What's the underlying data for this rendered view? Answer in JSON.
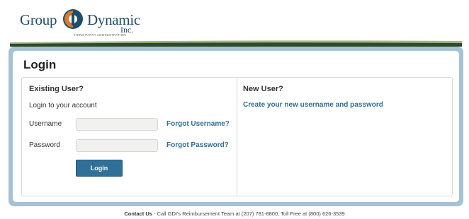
{
  "header": {
    "logo": {
      "word_left": "Group",
      "word_right": "Dynamic",
      "suffix": "Inc.",
      "tagline": "THIRD PARTY ADMINISTRATION"
    },
    "colors": {
      "brand_blue": "#1e4e6a",
      "band_dark": "#2d4a2a",
      "band_light": "#a8b58a"
    }
  },
  "page": {
    "title": "Login"
  },
  "existing_user": {
    "title": "Existing User?",
    "subtitle": "Login to your account",
    "username_label": "Username",
    "username_value": "",
    "forgot_username": "Forgot Username?",
    "password_label": "Password",
    "password_value": "",
    "forgot_password": "Forgot Password?",
    "login_button": "Login"
  },
  "new_user": {
    "title": "New User?",
    "create_link": "Create your new username and password"
  },
  "footer": {
    "contact_label": "Contact Us",
    "contact_text": " - Call GDI's Reimbursement Team at (207) 781-8800, Toll Free at (800) 626-3539"
  },
  "theme": {
    "accent": "#2f6f98",
    "frame": "#a6c2d6",
    "link": "#2f6f92"
  }
}
